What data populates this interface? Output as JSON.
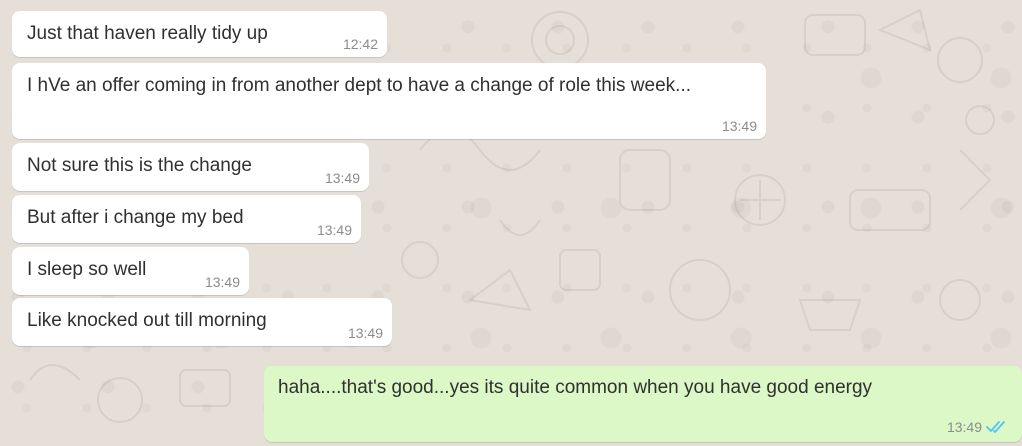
{
  "chat": {
    "messages": [
      {
        "direction": "incoming",
        "text": "Just that haven really tidy up",
        "time": "12:42"
      },
      {
        "direction": "incoming",
        "text": "I hVe an offer coming in from another dept to have a change of role this week...",
        "time": "13:49"
      },
      {
        "direction": "incoming",
        "text": "Not sure this is the change",
        "time": "13:49"
      },
      {
        "direction": "incoming",
        "text": "But after i change my bed",
        "time": "13:49"
      },
      {
        "direction": "incoming",
        "text": "I sleep so well",
        "time": "13:49"
      },
      {
        "direction": "incoming",
        "text": "Like knocked out till morning",
        "time": "13:49"
      },
      {
        "direction": "outgoing",
        "text": "haha....that's good...yes its quite common when you have good energy",
        "time": "13:49",
        "status": "read"
      }
    ]
  },
  "colors": {
    "wallpaper": "#e5ddd5",
    "incoming_bubble": "#ffffff",
    "outgoing_bubble": "#dcf8c6",
    "read_ticks": "#4fc3f7",
    "timestamp": "#8c8c8c"
  },
  "icons": {
    "read_receipt": "double-check-icon"
  }
}
